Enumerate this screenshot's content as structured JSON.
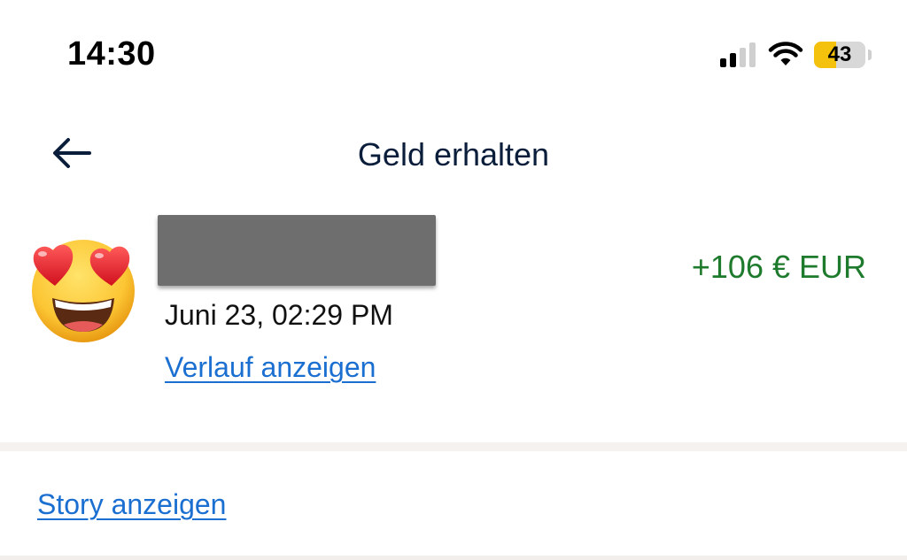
{
  "status_bar": {
    "time": "14:30",
    "signal_icon": "cellular-signal-icon",
    "wifi_icon": "wifi-icon",
    "battery_level": "43",
    "battery_fill_fraction": 0.43,
    "battery_fill_color": "#f4c20d"
  },
  "header": {
    "back_icon": "arrow-left-icon",
    "title": "Geld erhalten"
  },
  "transaction": {
    "avatar_icon": "heart-eyes-emoji-icon",
    "sender_name": "",
    "date": "Juni 23, 02:29 PM",
    "history_link": "Verlauf anzeigen",
    "amount": "+106 € EUR",
    "amount_color": "#1e7a2c"
  },
  "story_link": "Story anzeigen",
  "colors": {
    "link": "#1a6fd1",
    "title": "#0a1d3a",
    "redaction": "#6e6e6f"
  }
}
